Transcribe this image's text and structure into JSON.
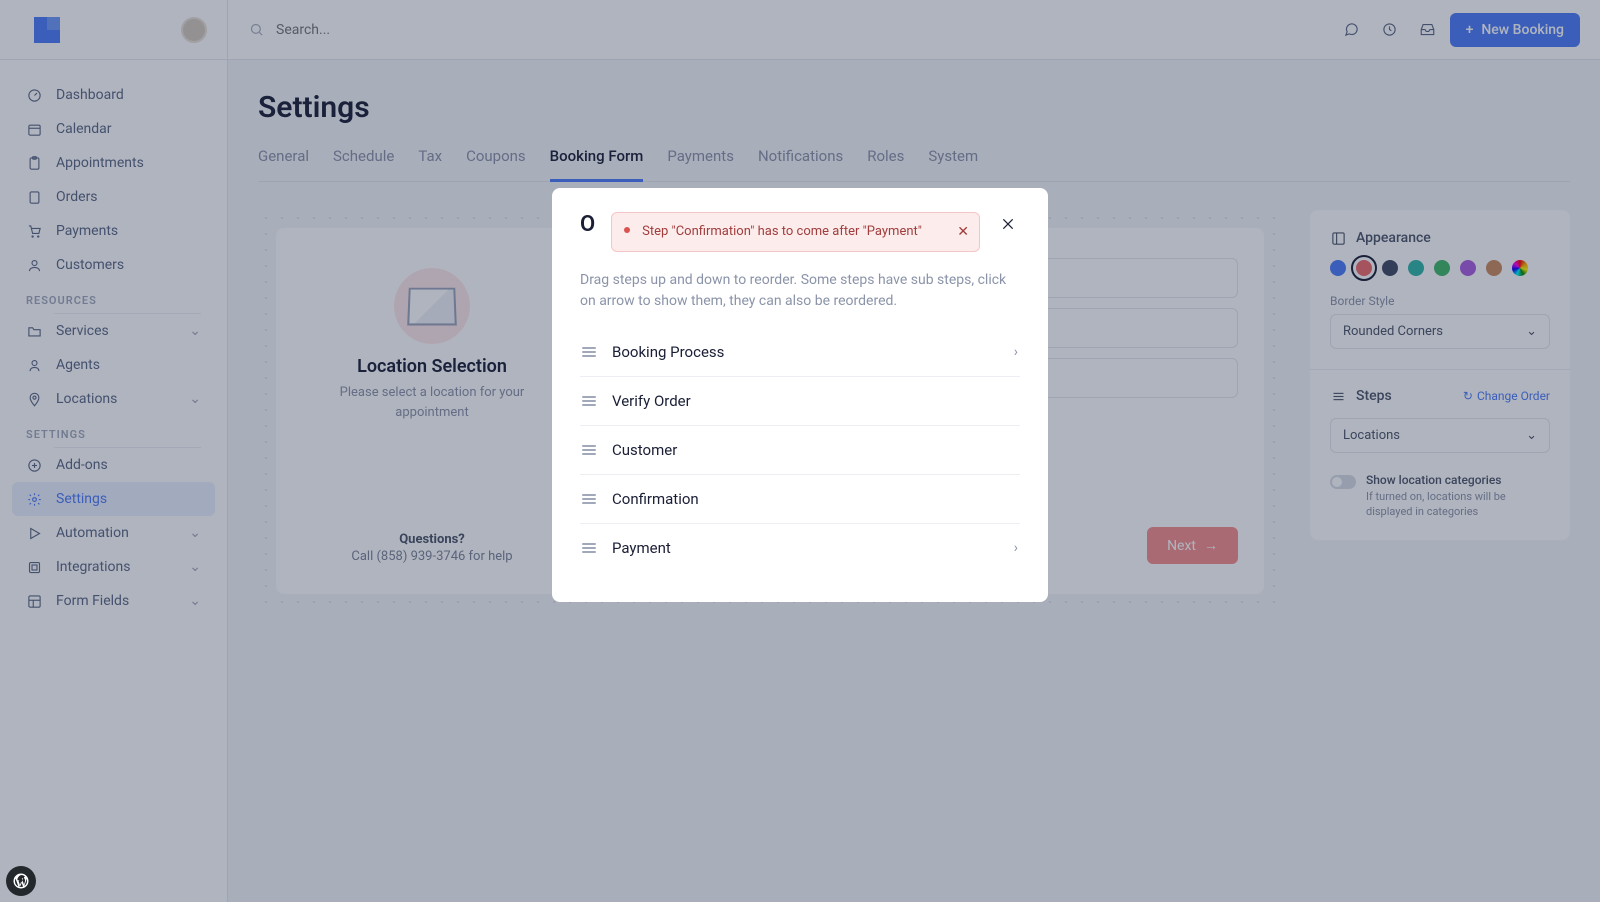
{
  "header": {
    "search_placeholder": "Search...",
    "new_booking_label": "New Booking"
  },
  "sidebar": {
    "main_items": [
      {
        "label": "Dashboard",
        "icon": "gauge-icon"
      },
      {
        "label": "Calendar",
        "icon": "calendar-icon"
      },
      {
        "label": "Appointments",
        "icon": "clipboard-icon"
      },
      {
        "label": "Orders",
        "icon": "tablet-icon"
      },
      {
        "label": "Payments",
        "icon": "cart-icon"
      },
      {
        "label": "Customers",
        "icon": "users-icon"
      }
    ],
    "section_resources": "RESOURCES",
    "resources_items": [
      {
        "label": "Services",
        "icon": "folder-icon",
        "chevron": true
      },
      {
        "label": "Agents",
        "icon": "person-icon"
      },
      {
        "label": "Locations",
        "icon": "pin-icon",
        "chevron": true
      }
    ],
    "section_settings": "SETTINGS",
    "settings_items": [
      {
        "label": "Add-ons",
        "icon": "plus-circle-icon"
      },
      {
        "label": "Settings",
        "icon": "gear-icon",
        "active": true
      },
      {
        "label": "Automation",
        "icon": "play-icon",
        "chevron": true
      },
      {
        "label": "Integrations",
        "icon": "link-icon",
        "chevron": true
      },
      {
        "label": "Form Fields",
        "icon": "layout-icon",
        "chevron": true
      }
    ]
  },
  "page": {
    "title": "Settings",
    "tabs": [
      "General",
      "Schedule",
      "Tax",
      "Coupons",
      "Booking Form",
      "Payments",
      "Notifications",
      "Roles",
      "System"
    ],
    "active_tab": "Booking Form"
  },
  "preview": {
    "loc_title": "Location Selection",
    "loc_sub": "Please select a location for your appointment",
    "questions_heading": "Questions?",
    "questions_phone": "Call (858) 939-3746 for help",
    "next_label": "Next"
  },
  "panel": {
    "appearance_title": "Appearance",
    "colors": [
      "#4a7bf7",
      "#ef6a6a",
      "#3e4a63",
      "#2fb5a8",
      "#3fb768",
      "#a95ee0",
      "#c98b5f",
      "rainbow"
    ],
    "selected_color_index": 1,
    "border_label": "Border Style",
    "border_value": "Rounded Corners",
    "steps_title": "Steps",
    "change_order_label": "Change Order",
    "steps_select_value": "Locations",
    "toggle_title": "Show location categories",
    "toggle_sub": "If turned on, locations will be displayed in categories"
  },
  "modal": {
    "title": "O",
    "alert_text": "Step \"Confirmation\" has to come after \"Payment\"",
    "description": "Drag steps up and down to reorder. Some steps have sub steps, click on arrow to show them, they can also be reordered.",
    "steps": [
      {
        "name": "Booking Process",
        "expandable": true
      },
      {
        "name": "Verify Order",
        "expandable": false
      },
      {
        "name": "Customer",
        "expandable": false
      },
      {
        "name": "Confirmation",
        "expandable": false
      },
      {
        "name": "Payment",
        "expandable": true
      }
    ]
  }
}
